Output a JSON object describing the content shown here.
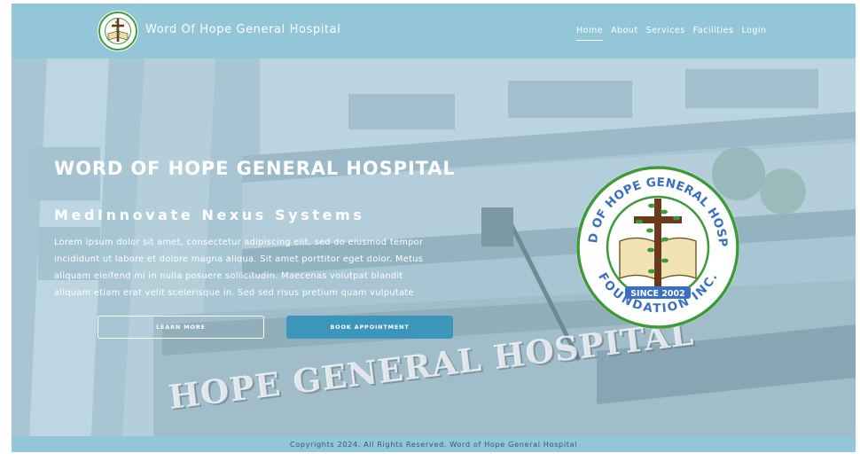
{
  "navbar": {
    "brand_name": "Word Of Hope General Hospital",
    "links": [
      {
        "label": "Home",
        "active": true
      },
      {
        "label": "About",
        "active": false
      },
      {
        "label": "Services",
        "active": false
      },
      {
        "label": "Facilities",
        "active": false
      },
      {
        "label": "Login",
        "active": false
      }
    ]
  },
  "hero": {
    "title": "WORD OF HOPE GENERAL HOSPITAL",
    "subtitle": "MedInnovate Nexus Systems",
    "body_lines": [
      "Lorem ipsum dolor sit amet, consectetur adipiscing elit, sed do eiusmod tempor",
      "incididunt ut labore et dolore magna aliqua. Sit amet porttitor eget dolor. Metus",
      "aliquam eleifend mi in nulla posuere sollicitudin. Maecenas volutpat blandit",
      "aliquam etiam erat velit scelerisque in. Sed sed risus pretium quam vulputate"
    ],
    "learn_more_label": "LEARN MORE",
    "book_appointment_label": "BOOK APPOINTMENT",
    "building_sign": "HOPE GENERAL HOSPITAL"
  },
  "emblem": {
    "top_text": "WORD OF HOPE GENERAL HOSPITAL",
    "bottom_text": "FOUNDATION INC.",
    "since": "SINCE 2002"
  },
  "footer": {
    "text": "Copyrights 2024. All Rights Reserved. Word of Hope General Hospital"
  },
  "colors": {
    "navbar": "#93c6d8",
    "primary_button": "#3c95bb",
    "emblem_green": "#3d9a3a",
    "emblem_blue": "#3b6fc4"
  }
}
